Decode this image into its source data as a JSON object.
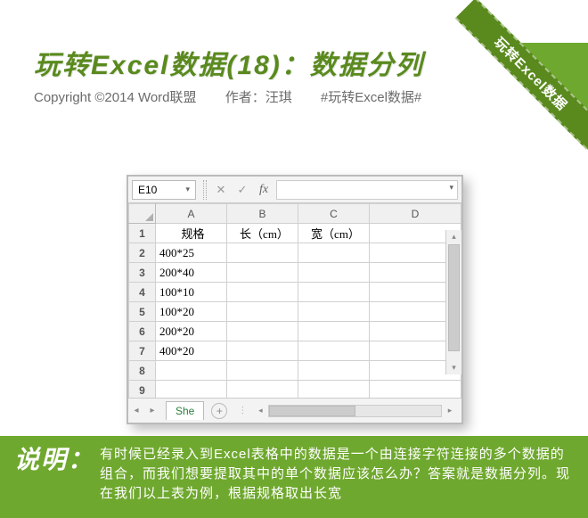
{
  "ribbon": {
    "text": "玩转Excel数据"
  },
  "title": "玩转Excel数据(18)：数据分列",
  "meta": {
    "copyright": "Copyright ©2014 Word联盟",
    "author": "作者：汪琪",
    "tag": "#玩转Excel数据#"
  },
  "excel": {
    "namebox": "E10",
    "sheet_tab": "She",
    "columns": [
      "A",
      "B",
      "C",
      "D"
    ],
    "row_numbers": [
      1,
      2,
      3,
      4,
      5,
      6,
      7,
      8,
      9
    ],
    "headers": {
      "A": "规格",
      "B": "长（cm）",
      "C": "宽（cm）"
    },
    "data": {
      "r2": "400*25",
      "r3": "200*40",
      "r4": "100*10",
      "r5": "100*20",
      "r6": "200*20",
      "r7": "400*20"
    }
  },
  "caption": {
    "label": "说明：",
    "text": "有时候已经录入到Excel表格中的数据是一个由连接字符连接的多个数据的组合，而我们想要提取其中的单个数据应该怎么办？答案就是数据分列。现在我们以上表为例，根据规格取出长宽"
  },
  "chart_data": {
    "type": "table",
    "title": "规格",
    "columns": [
      "规格",
      "长（cm）",
      "宽（cm）"
    ],
    "rows": [
      [
        "400*25",
        "",
        ""
      ],
      [
        "200*40",
        "",
        ""
      ],
      [
        "100*10",
        "",
        ""
      ],
      [
        "100*20",
        "",
        ""
      ],
      [
        "200*20",
        "",
        ""
      ],
      [
        "400*20",
        "",
        ""
      ]
    ]
  }
}
